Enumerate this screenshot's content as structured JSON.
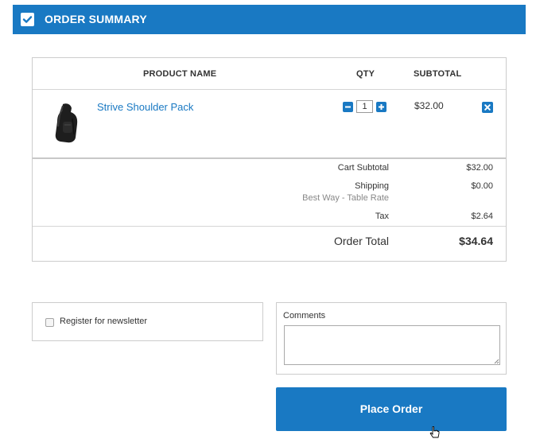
{
  "header": {
    "title": "ORDER SUMMARY",
    "icon": "checkbox-checked-icon"
  },
  "columns": {
    "product": "PRODUCT NAME",
    "qty": "QTY",
    "subtotal": "SUBTOTAL"
  },
  "item": {
    "name": "Strive Shoulder Pack",
    "qty": "1",
    "subtotal": "$32.00"
  },
  "totals": {
    "cart_subtotal_label": "Cart Subtotal",
    "cart_subtotal_value": "$32.00",
    "shipping_label": "Shipping",
    "shipping_method": "Best Way - Table Rate",
    "shipping_value": "$0.00",
    "tax_label": "Tax",
    "tax_value": "$2.64",
    "order_total_label": "Order Total",
    "order_total_value": "$34.64"
  },
  "newsletter": {
    "label": "Register for newsletter",
    "checked": false
  },
  "comments": {
    "label": "Comments",
    "value": ""
  },
  "place_order": {
    "label": "Place Order"
  },
  "colors": {
    "accent": "#1979c3",
    "link": "#1979c3",
    "border": "#cccccc",
    "muted": "#888888"
  }
}
